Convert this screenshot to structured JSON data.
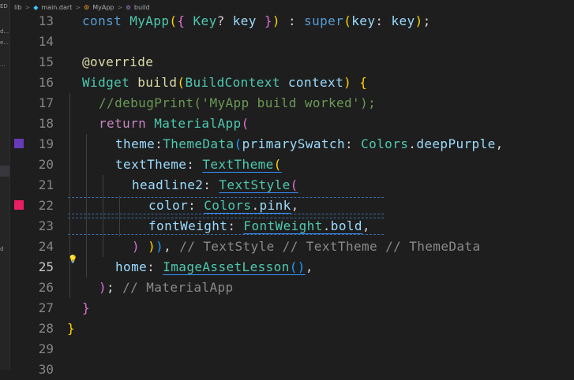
{
  "breadcrumb": {
    "items": [
      "lib",
      "main.dart",
      "MyApp",
      "build"
    ],
    "separators": [
      ">",
      ">",
      ">"
    ]
  },
  "sidebar": {
    "fragments": [
      "ED",
      "d...",
      "e...",
      "...",
      "d"
    ]
  },
  "colors": {
    "gutter_deep_purple": "#673ab7",
    "gutter_pink": "#e91e63",
    "editor_background": "#1e1e1e"
  },
  "icons": [
    "lightbulb-icon",
    "dart-file-icon",
    "class-icon",
    "method-icon"
  ],
  "editor": {
    "active_line": 25,
    "lines": [
      {
        "num": "13",
        "indent": 1,
        "tokens": [
          {
            "t": "const ",
            "c": "kw"
          },
          {
            "t": "MyApp",
            "c": "cls"
          },
          {
            "t": "(",
            "c": "br1"
          },
          {
            "t": "{ ",
            "c": "br2"
          },
          {
            "t": "Key",
            "c": "cls"
          },
          {
            "t": "? ",
            "c": "op"
          },
          {
            "t": "key",
            "c": "param"
          },
          {
            "t": " }",
            "c": "br2"
          },
          {
            "t": ")",
            "c": "br1"
          },
          {
            "t": " : ",
            "c": "op"
          },
          {
            "t": "super",
            "c": "kw"
          },
          {
            "t": "(",
            "c": "br1"
          },
          {
            "t": "key",
            "c": "param"
          },
          {
            "t": ": ",
            "c": "op"
          },
          {
            "t": "key",
            "c": "param"
          },
          {
            "t": ")",
            "c": "br1"
          },
          {
            "t": ";",
            "c": "op"
          }
        ]
      },
      {
        "num": "14",
        "indent": 1,
        "tokens": []
      },
      {
        "num": "15",
        "indent": 1,
        "tokens": [
          {
            "t": "@override",
            "c": "anno"
          }
        ]
      },
      {
        "num": "16",
        "indent": 1,
        "tokens": [
          {
            "t": "Widget ",
            "c": "cls"
          },
          {
            "t": "build",
            "c": "fn"
          },
          {
            "t": "(",
            "c": "br1"
          },
          {
            "t": "BuildContext ",
            "c": "cls"
          },
          {
            "t": "context",
            "c": "param"
          },
          {
            "t": ")",
            "c": "br1"
          },
          {
            "t": " {",
            "c": "br1"
          }
        ]
      },
      {
        "num": "17",
        "indent": 2,
        "tokens": [
          {
            "t": "//debugPrint('MyApp build worked');",
            "c": "cm"
          }
        ]
      },
      {
        "num": "18",
        "indent": 2,
        "tokens": [
          {
            "t": "return ",
            "c": "ctrl"
          },
          {
            "t": "MaterialApp",
            "c": "cls"
          },
          {
            "t": "(",
            "c": "br2"
          }
        ]
      },
      {
        "num": "19",
        "indent": 3,
        "gutter": "deep_purple",
        "tokens": [
          {
            "t": "theme",
            "c": "param"
          },
          {
            "t": ":",
            "c": "op"
          },
          {
            "t": "ThemeData",
            "c": "cls"
          },
          {
            "t": "(",
            "c": "br3"
          },
          {
            "t": "primarySwatch",
            "c": "param"
          },
          {
            "t": ": ",
            "c": "op"
          },
          {
            "t": "Colors",
            "c": "cls"
          },
          {
            "t": ".",
            "c": "op"
          },
          {
            "t": "deepPurple",
            "c": "param"
          },
          {
            "t": ",",
            "c": "op"
          }
        ]
      },
      {
        "num": "20",
        "indent": 3,
        "tokens": [
          {
            "t": "textTheme",
            "c": "param"
          },
          {
            "t": ": ",
            "c": "op"
          },
          {
            "t": "TextTheme",
            "c": "cls",
            "u": true
          },
          {
            "t": "(",
            "c": "br1",
            "u": true
          }
        ]
      },
      {
        "num": "21",
        "indent": 4,
        "tokens": [
          {
            "t": "headline2",
            "c": "param"
          },
          {
            "t": ": ",
            "c": "op"
          },
          {
            "t": "TextStyle",
            "c": "cls",
            "u": true
          },
          {
            "t": "(",
            "c": "br2",
            "u": true
          }
        ]
      },
      {
        "num": "22",
        "indent": 5,
        "gutter": "pink",
        "hl": true,
        "tokens": [
          {
            "t": "color",
            "c": "param"
          },
          {
            "t": ": ",
            "c": "op"
          },
          {
            "t": "Colors",
            "c": "cls",
            "u": true
          },
          {
            "t": ".",
            "c": "op",
            "u": true
          },
          {
            "t": "pink",
            "c": "param",
            "u": true
          },
          {
            "t": ",",
            "c": "op"
          }
        ]
      },
      {
        "num": "23",
        "indent": 5,
        "hl": true,
        "tokens": [
          {
            "t": "fontWeight",
            "c": "param"
          },
          {
            "t": ": ",
            "c": "op"
          },
          {
            "t": "FontWeight",
            "c": "cls",
            "u": true
          },
          {
            "t": ".",
            "c": "op",
            "u": true
          },
          {
            "t": "bold",
            "c": "param",
            "u": true
          },
          {
            "t": ",",
            "c": "op"
          }
        ]
      },
      {
        "num": "24",
        "indent": 4,
        "tokens": [
          {
            "t": ") ",
            "c": "br2"
          },
          {
            "t": ")",
            "c": "br1"
          },
          {
            "t": ")",
            "c": "br3"
          },
          {
            "t": ", ",
            "c": "op"
          },
          {
            "t": "// TextStyle // TextTheme // ThemeData",
            "c": "cmg"
          }
        ]
      },
      {
        "num": "25",
        "indent": 3,
        "bulb": true,
        "tokens": [
          {
            "t": "home",
            "c": "param"
          },
          {
            "t": ": ",
            "c": "op"
          },
          {
            "t": "ImageAssetLesson",
            "c": "cls",
            "u": true
          },
          {
            "t": "()",
            "c": "br3",
            "u": true
          },
          {
            "t": ",",
            "c": "op"
          }
        ]
      },
      {
        "num": "26",
        "indent": 2,
        "tokens": [
          {
            "t": ")",
            "c": "br2"
          },
          {
            "t": "; ",
            "c": "op"
          },
          {
            "t": "// MaterialApp",
            "c": "cmg"
          }
        ]
      },
      {
        "num": "27",
        "indent": 1,
        "tokens": [
          {
            "t": "}",
            "c": "br2"
          }
        ]
      },
      {
        "num": "28",
        "indent": 0,
        "tokens": [
          {
            "t": "}",
            "c": "br1"
          }
        ]
      },
      {
        "num": "29",
        "indent": 0,
        "tokens": []
      },
      {
        "num": "30",
        "indent": 0,
        "tokens": []
      }
    ]
  }
}
